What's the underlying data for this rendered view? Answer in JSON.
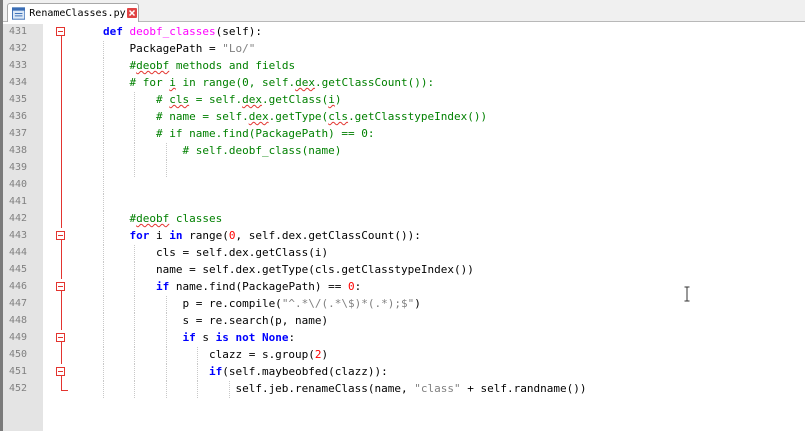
{
  "tab": {
    "filename": "RenameClasses.py"
  },
  "icons": {
    "file": "file-icon",
    "close": "close-icon",
    "fold": "fold-minus-icon",
    "cursor": "text-cursor-icon"
  },
  "colors": {
    "keyword": "#0000ff",
    "function": "#ff00ff",
    "string": "#808080",
    "number": "#ff0000",
    "comment": "#008000",
    "fold": "#e3342f"
  },
  "lines": [
    {
      "n": "431",
      "tokens": [
        [
          "kw",
          "def "
        ],
        [
          "fn",
          "deobf_classes"
        ],
        [
          "",
          "(self):"
        ]
      ]
    },
    {
      "n": "432",
      "tokens": [
        [
          "",
          "    PackagePath = "
        ],
        [
          "str",
          "\"Lo/\""
        ]
      ]
    },
    {
      "n": "433",
      "tokens": [
        [
          "cm",
          "    #"
        ],
        [
          "cm sq",
          "deobf"
        ],
        [
          "cm",
          " methods and fields"
        ]
      ]
    },
    {
      "n": "434",
      "tokens": [
        [
          "cm",
          "    # for "
        ],
        [
          "cm sq",
          "i"
        ],
        [
          "cm",
          " in range(0, self."
        ],
        [
          "cm sq",
          "dex"
        ],
        [
          "cm",
          ".getClassCount()):"
        ]
      ]
    },
    {
      "n": "435",
      "tokens": [
        [
          "cm",
          "        # "
        ],
        [
          "cm sq",
          "cls"
        ],
        [
          "cm",
          " = self."
        ],
        [
          "cm sq",
          "dex"
        ],
        [
          "cm",
          ".getClass("
        ],
        [
          "cm sq",
          "i"
        ],
        [
          "cm",
          ")"
        ]
      ]
    },
    {
      "n": "436",
      "tokens": [
        [
          "cm",
          "        # name = self."
        ],
        [
          "cm sq",
          "dex"
        ],
        [
          "cm",
          ".getType("
        ],
        [
          "cm sq",
          "cls"
        ],
        [
          "cm",
          ".getClasstypeIndex())"
        ]
      ]
    },
    {
      "n": "437",
      "tokens": [
        [
          "cm",
          "        # if name.find(PackagePath) == 0:"
        ]
      ]
    },
    {
      "n": "438",
      "tokens": [
        [
          "cm",
          "            # self.deobf_class(name)"
        ]
      ]
    },
    {
      "n": "439",
      "tokens": []
    },
    {
      "n": "440",
      "tokens": []
    },
    {
      "n": "441",
      "tokens": []
    },
    {
      "n": "442",
      "tokens": [
        [
          "cm",
          "    #"
        ],
        [
          "cm sq",
          "deobf"
        ],
        [
          "cm",
          " classes"
        ]
      ]
    },
    {
      "n": "443",
      "tokens": [
        [
          "kw",
          "    for"
        ],
        [
          "",
          " i "
        ],
        [
          "kw",
          "in"
        ],
        [
          "",
          " range("
        ],
        [
          "num",
          "0"
        ],
        [
          "",
          ", self.dex.getClassCount()):"
        ]
      ]
    },
    {
      "n": "444",
      "tokens": [
        [
          "",
          "        cls = self.dex.getClass(i)"
        ]
      ]
    },
    {
      "n": "445",
      "tokens": [
        [
          "",
          "        name = self.dex.getType(cls.getClasstypeIndex())"
        ]
      ]
    },
    {
      "n": "446",
      "tokens": [
        [
          "kw",
          "        if"
        ],
        [
          "",
          " name.find(PackagePath) == "
        ],
        [
          "num",
          "0"
        ],
        [
          "",
          ":"
        ]
      ]
    },
    {
      "n": "447",
      "tokens": [
        [
          "",
          "            p = re.compile("
        ],
        [
          "str",
          "\"^.*\\/(.*\\$)*(.*);$\""
        ],
        [
          "",
          ")"
        ]
      ]
    },
    {
      "n": "448",
      "tokens": [
        [
          "",
          "            s = re.search(p, name)"
        ]
      ]
    },
    {
      "n": "449",
      "tokens": [
        [
          "kw",
          "            if"
        ],
        [
          "",
          " s "
        ],
        [
          "kw",
          "is not None"
        ],
        [
          "",
          ":"
        ]
      ]
    },
    {
      "n": "450",
      "tokens": [
        [
          "",
          "                clazz = s.group("
        ],
        [
          "num",
          "2"
        ],
        [
          "",
          ")"
        ]
      ]
    },
    {
      "n": "451",
      "tokens": [
        [
          "kw",
          "                if"
        ],
        [
          "",
          "(self.maybeobfed(clazz)):"
        ]
      ]
    },
    {
      "n": "452",
      "tokens": [
        [
          "",
          "                    self.jeb.renameClass(name, "
        ],
        [
          "str",
          "\"class\""
        ],
        [
          "",
          " + self.randname())"
        ]
      ]
    }
  ]
}
